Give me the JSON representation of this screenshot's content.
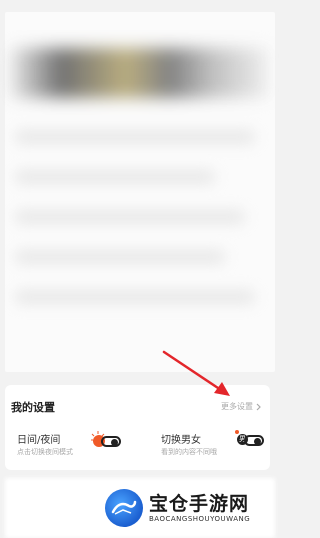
{
  "settings": {
    "title": "我的设置",
    "more_label": "更多设置",
    "more_icon": "chevron-right-icon",
    "items": [
      {
        "title": "日间/夜间",
        "subtitle": "点击切换夜间模式",
        "icon": "sun-toggle-icon"
      },
      {
        "title": "切换男女",
        "subtitle": "看到的内容不同哦",
        "icon": "gender-toggle-icon",
        "badge": "男"
      }
    ]
  },
  "watermark": {
    "name_cn": "宝仓手游网",
    "name_en": "BAOCANGSHOUYOUWANG"
  },
  "colors": {
    "accent": "#f05a28",
    "arrow": "#e3262b",
    "logo_blue": "#1b5fd0"
  }
}
